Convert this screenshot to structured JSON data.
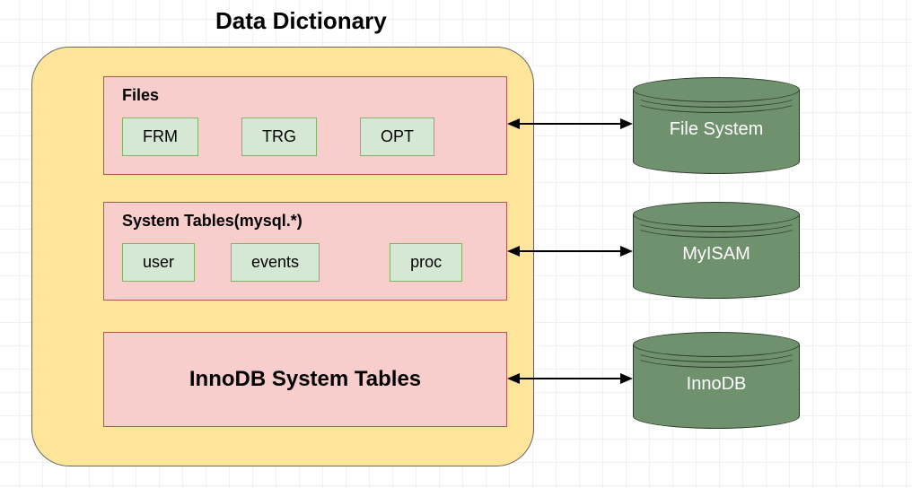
{
  "title": "Data Dictionary",
  "boxes": {
    "files": {
      "title": "Files",
      "items": [
        "FRM",
        "TRG",
        "OPT"
      ]
    },
    "system": {
      "title": "System Tables(mysql.*)",
      "items": [
        "user",
        "events",
        "proc"
      ]
    },
    "innodb": {
      "title": "InnoDB System Tables"
    }
  },
  "storages": {
    "fs": "File System",
    "myisam": "MyISAM",
    "innodb": "InnoDB"
  }
}
